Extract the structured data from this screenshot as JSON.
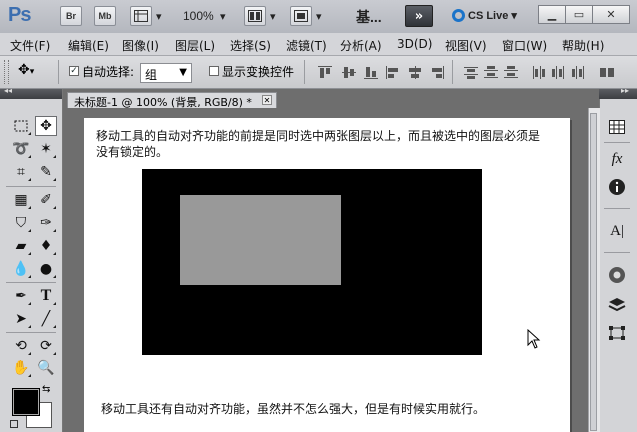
{
  "titlebar": {
    "logo": "Ps",
    "bridge_label": "Br",
    "minibridge_label": "Mb",
    "zoom": "100%",
    "workspace": "基...",
    "cs_live": "CS Live"
  },
  "menubar": {
    "items": [
      "文件(F)",
      "编辑(E)",
      "图像(I)",
      "图层(L)",
      "选择(S)",
      "滤镜(T)",
      "分析(A)",
      "3D(D)",
      "视图(V)",
      "窗口(W)",
      "帮助(H)"
    ]
  },
  "options": {
    "auto_select_label": "自动选择:",
    "auto_select_value": "组",
    "show_transform_label": "显示变换控件"
  },
  "document": {
    "tab_title": "未标题-1 @ 100% (背景, RGB/8) *",
    "paragraph1": "移动工具的自动对齐功能的前提是同时选中两张图层以上，而且被选中的图层必须是没有锁定的。",
    "paragraph2": "移动工具还有自动对齐功能，虽然并不怎么强大，但是有时候实用就行。"
  },
  "colors": {
    "foreground": "#000000",
    "background": "#ffffff",
    "gray_rect": "#999999"
  },
  "icons": [
    "move-icon",
    "marquee-icon",
    "lasso-icon",
    "magic-wand-icon",
    "crop-icon",
    "eyedropper-icon",
    "healing-icon",
    "brush-icon",
    "stamp-icon",
    "history-brush-icon",
    "eraser-icon",
    "paint-bucket-icon",
    "blur-icon",
    "dodge-icon",
    "pen-icon",
    "type-icon",
    "path-select-icon",
    "line-icon",
    "3d-rotate-icon",
    "3d-orbit-icon",
    "hand-icon",
    "zoom-icon"
  ]
}
